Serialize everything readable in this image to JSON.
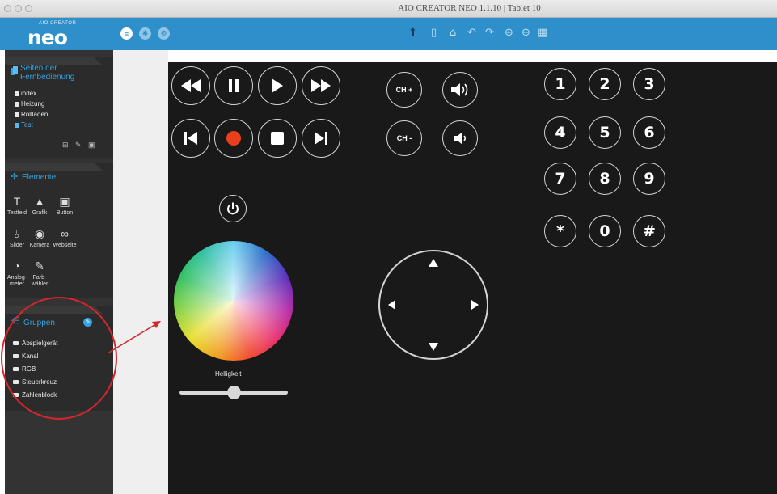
{
  "window": {
    "title": "AIO CREATOR NEO 1.1.10 | Tablet 10"
  },
  "app": {
    "logo_small": "AIO CREATOR",
    "logo_big": "neo"
  },
  "toolbar": {
    "left_icons": [
      "menu-icon",
      "remote-icon",
      "settings-icon"
    ],
    "center_icons": [
      "upload-icon",
      "tablet-icon",
      "home-icon",
      "undo-icon",
      "redo-icon",
      "zoom-in-icon",
      "zoom-out-icon",
      "grid-icon"
    ]
  },
  "pages": {
    "heading": "Seiten der Fernbedienung",
    "items": [
      {
        "label": "index",
        "active": false
      },
      {
        "label": "Heizung",
        "active": false
      },
      {
        "label": "Rollladen",
        "active": false
      },
      {
        "label": "Test",
        "active": true
      }
    ]
  },
  "elements": {
    "heading": "Elemente",
    "items": [
      {
        "label": "Textfeld",
        "icon": "textfield-icon"
      },
      {
        "label": "Grafik",
        "icon": "image-icon"
      },
      {
        "label": "Button",
        "icon": "button-icon"
      },
      {
        "label": "Slider",
        "icon": "slider-icon"
      },
      {
        "label": "Kamera",
        "icon": "camera-icon"
      },
      {
        "label": "Webseite",
        "icon": "link-icon"
      },
      {
        "label": "Analog-\nmeter",
        "icon": "gauge-icon"
      },
      {
        "label": "Farb-\nwähler",
        "icon": "color-picker-icon"
      }
    ]
  },
  "groups": {
    "heading": "Gruppen",
    "items": [
      "Abspielgerät",
      "Kanal",
      "RGB",
      "Steuerkreuz",
      "Zahlenblock"
    ]
  },
  "remote": {
    "channel_up": "CH +",
    "channel_down": "CH -",
    "keypad": [
      "1",
      "2",
      "3",
      "4",
      "5",
      "6",
      "7",
      "8",
      "9",
      "*",
      "0",
      "#"
    ],
    "brightness_label": "Helligkeit",
    "brightness_value": 0.5
  },
  "colors": {
    "accent": "#2f8fca",
    "sidebar_bg": "#333333",
    "canvas_bg": "#191919",
    "record": "#e8401c",
    "annotation": "#d6262d"
  }
}
